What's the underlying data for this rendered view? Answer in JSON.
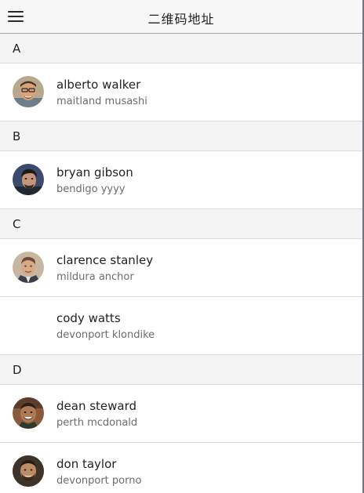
{
  "header": {
    "title": "二维码地址",
    "menu_icon": "hamburger-menu-icon"
  },
  "sections": [
    {
      "letter": "A",
      "contacts": [
        {
          "name": "alberto walker",
          "location": "maitland musashi",
          "has_avatar": true
        }
      ]
    },
    {
      "letter": "B",
      "contacts": [
        {
          "name": "bryan gibson",
          "location": "bendigo yyyy",
          "has_avatar": true
        }
      ]
    },
    {
      "letter": "C",
      "contacts": [
        {
          "name": "clarence stanley",
          "location": "mildura anchor",
          "has_avatar": true
        },
        {
          "name": "cody watts",
          "location": "devonport klondike",
          "has_avatar": false
        }
      ]
    },
    {
      "letter": "D",
      "contacts": [
        {
          "name": "dean steward",
          "location": "perth mcdonald",
          "has_avatar": true
        },
        {
          "name": "don taylor",
          "location": "devonport porno",
          "has_avatar": true
        }
      ]
    }
  ]
}
